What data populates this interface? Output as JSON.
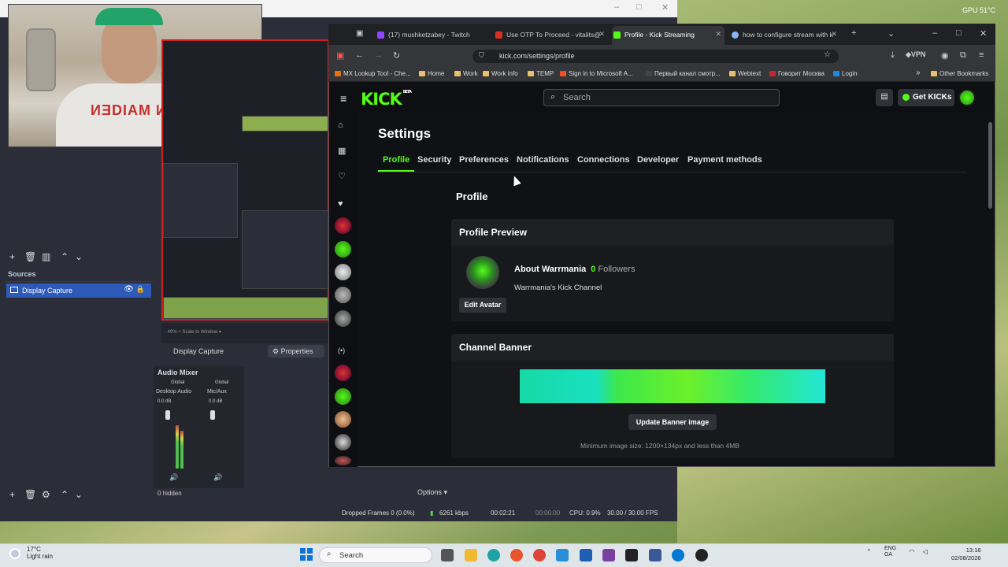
{
  "system": {
    "gpu": "GPU 51°C"
  },
  "obs": {
    "sources_title": "Sources",
    "source_item": "Display Capture",
    "hidden_count": "0 hidden",
    "display_capture_label": "Display Capture",
    "properties_label": "Properties",
    "audio_mixer_title": "Audio Mixer",
    "options_label": "Options",
    "mixer": {
      "ch1": {
        "label": "Global",
        "name": "Desktop Audio",
        "db": "0.0 dB"
      },
      "ch2": {
        "label": "Global",
        "name": "Mic/Aux",
        "db": "0.0 dB"
      }
    },
    "status": {
      "dropped": "Dropped Frames 0 (0.0%)",
      "kbps": "6261 kbps",
      "time1": "00:02:21",
      "time2": "00:00:00",
      "cpu": "CPU: 0.9%",
      "fps": "30.00 / 30.00 FPS"
    }
  },
  "browser": {
    "tabs": [
      {
        "label": "(17) mushketzabey - Twitch",
        "color": "#9146ff"
      },
      {
        "label": "Use OTP To Proceed - vitalits@",
        "color": "#d93025"
      },
      {
        "label": "Profile - Kick Streaming",
        "color": "#53fc18"
      },
      {
        "label": "how to configure stream with k",
        "color": "#8ab4f8"
      }
    ],
    "url": "kick.com/settings/profile",
    "vpn_label": "VPN",
    "bookmarks": [
      {
        "label": "MX Lookup Tool - Che...",
        "color": "#e8710a"
      },
      {
        "label": "Home",
        "color": "#e8c26a"
      },
      {
        "label": "Work",
        "color": "#e8c26a"
      },
      {
        "label": "Work info",
        "color": "#e8c26a"
      },
      {
        "label": "TEMP",
        "color": "#e8c26a"
      },
      {
        "label": "Sign in to Microsoft A...",
        "color": "#f25022"
      },
      {
        "label": "Первый канал смотр...",
        "color": "#444"
      },
      {
        "label": "Webtext",
        "color": "#e8c26a"
      },
      {
        "label": "Говорит Москва",
        "color": "#c62828"
      },
      {
        "label": "Login",
        "color": "#1e88e5"
      }
    ],
    "other_bookmarks": "Other Bookmarks"
  },
  "kick": {
    "logo": "KICK",
    "logo_badge": "BETA",
    "search_placeholder": "Search",
    "get_kicks": "Get KICKs",
    "settings_title": "Settings",
    "tabs": [
      "Profile",
      "Security",
      "Preferences",
      "Notifications",
      "Connections",
      "Developer",
      "Payment methods"
    ],
    "profile_heading": "Profile",
    "profile_preview_title": "Profile Preview",
    "about_label": "About Warrmania",
    "followers_count": "0",
    "followers_label": "Followers",
    "channel_desc": "Warrmania's Kick Channel",
    "edit_avatar": "Edit Avatar",
    "channel_banner_title": "Channel Banner",
    "update_banner": "Update Banner image",
    "min_size": "Minimum image size: 1200×134px and less than 4MB",
    "accent": "#53fc18"
  },
  "taskbar": {
    "weather_temp": "17°C",
    "weather_desc": "Light rain",
    "search": "Search",
    "lang1": "ENG",
    "lang2": "GA",
    "time": "13:16",
    "date": "02/08/2026"
  }
}
